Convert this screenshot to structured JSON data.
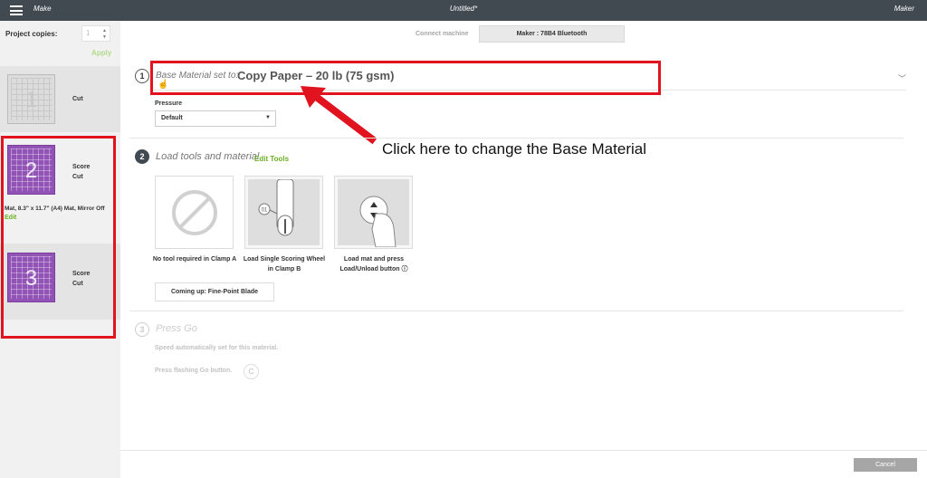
{
  "topbar": {
    "app_title": "Make",
    "doc_title": "Untitled*",
    "machine_name": "Maker"
  },
  "sidebar": {
    "copies_label": "Project copies:",
    "copies_value": "1",
    "apply_label": "Apply",
    "mats": [
      {
        "number": "1",
        "ops": [
          "Cut"
        ]
      },
      {
        "number": "2",
        "ops": [
          "Score",
          "Cut"
        ],
        "description": "Mat, 8.3\" x 11.7\" (A4) Mat, Mirror Off",
        "edit_label": "Edit"
      },
      {
        "number": "3",
        "ops": [
          "Score",
          "Cut"
        ]
      }
    ]
  },
  "header": {
    "connect_label": "Connect machine",
    "machine_button": "Maker : 78B4 Bluetooth"
  },
  "step1": {
    "number": "1",
    "prefix": "Base Material set to:",
    "material": "Copy Paper – 20 lb (75 gsm)",
    "pressure_label": "Pressure",
    "pressure_value": "Default"
  },
  "annotation": {
    "text": "Click here to change the Base Material",
    "color": "#e0131e"
  },
  "step2": {
    "number": "2",
    "title": "Load tools and material",
    "edit_tools": "Edit Tools",
    "tools": [
      {
        "caption": "No tool required in Clamp A"
      },
      {
        "caption": "Load Single Scoring Wheel in Clamp B",
        "label": "01"
      },
      {
        "caption": "Load mat and press Load/Unload button ⓘ"
      }
    ],
    "coming_up": "Coming up: Fine-Point Blade"
  },
  "step3": {
    "number": "3",
    "title": "Press Go",
    "line1": "Speed automatically set for this material.",
    "line2": "Press flashing Go button.",
    "go_glyph": "C"
  },
  "footer": {
    "cancel_label": "Cancel"
  }
}
